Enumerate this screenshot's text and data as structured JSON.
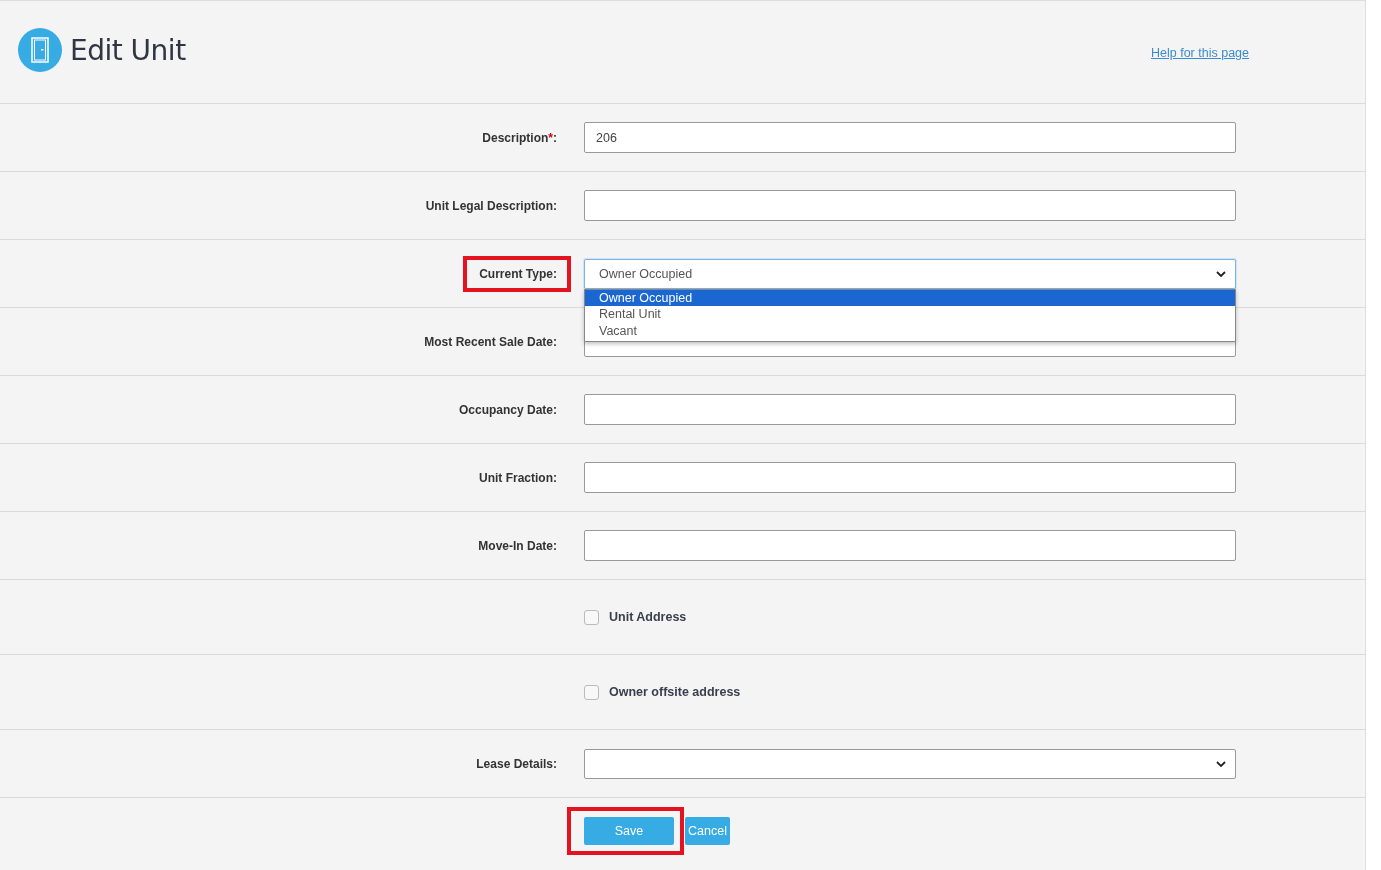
{
  "header": {
    "title": "Edit Unit",
    "help_link": "Help for this page"
  },
  "fields": [
    {
      "kind": "text",
      "label": "Description",
      "required_mark": "*",
      "label_suffix": ":",
      "value": "206"
    },
    {
      "kind": "text",
      "label": "Unit Legal Description:"
    },
    {
      "kind": "select",
      "label": "Current Type:",
      "value": "Owner Occupied",
      "highlighted": true,
      "expanded": true,
      "options": [
        {
          "label": "Owner Occupied",
          "selected": true
        },
        {
          "label": "Rental Unit",
          "selected": false
        },
        {
          "label": "Vacant",
          "selected": false
        }
      ]
    },
    {
      "kind": "text",
      "label": "Most Recent Sale Date:"
    },
    {
      "kind": "text",
      "label": "Occupancy Date:"
    },
    {
      "kind": "text",
      "label": "Unit Fraction:"
    },
    {
      "kind": "text",
      "label": "Move-In Date:"
    },
    {
      "kind": "checkbox",
      "label": "Unit Address",
      "checked": false
    },
    {
      "kind": "checkbox",
      "label": "Owner offsite address",
      "checked": false
    },
    {
      "kind": "select",
      "label": "Lease Details:",
      "expanded": false
    }
  ],
  "buttons": [
    {
      "label": "Save",
      "highlighted": true
    },
    {
      "label": "Cancel",
      "highlighted": false
    }
  ]
}
